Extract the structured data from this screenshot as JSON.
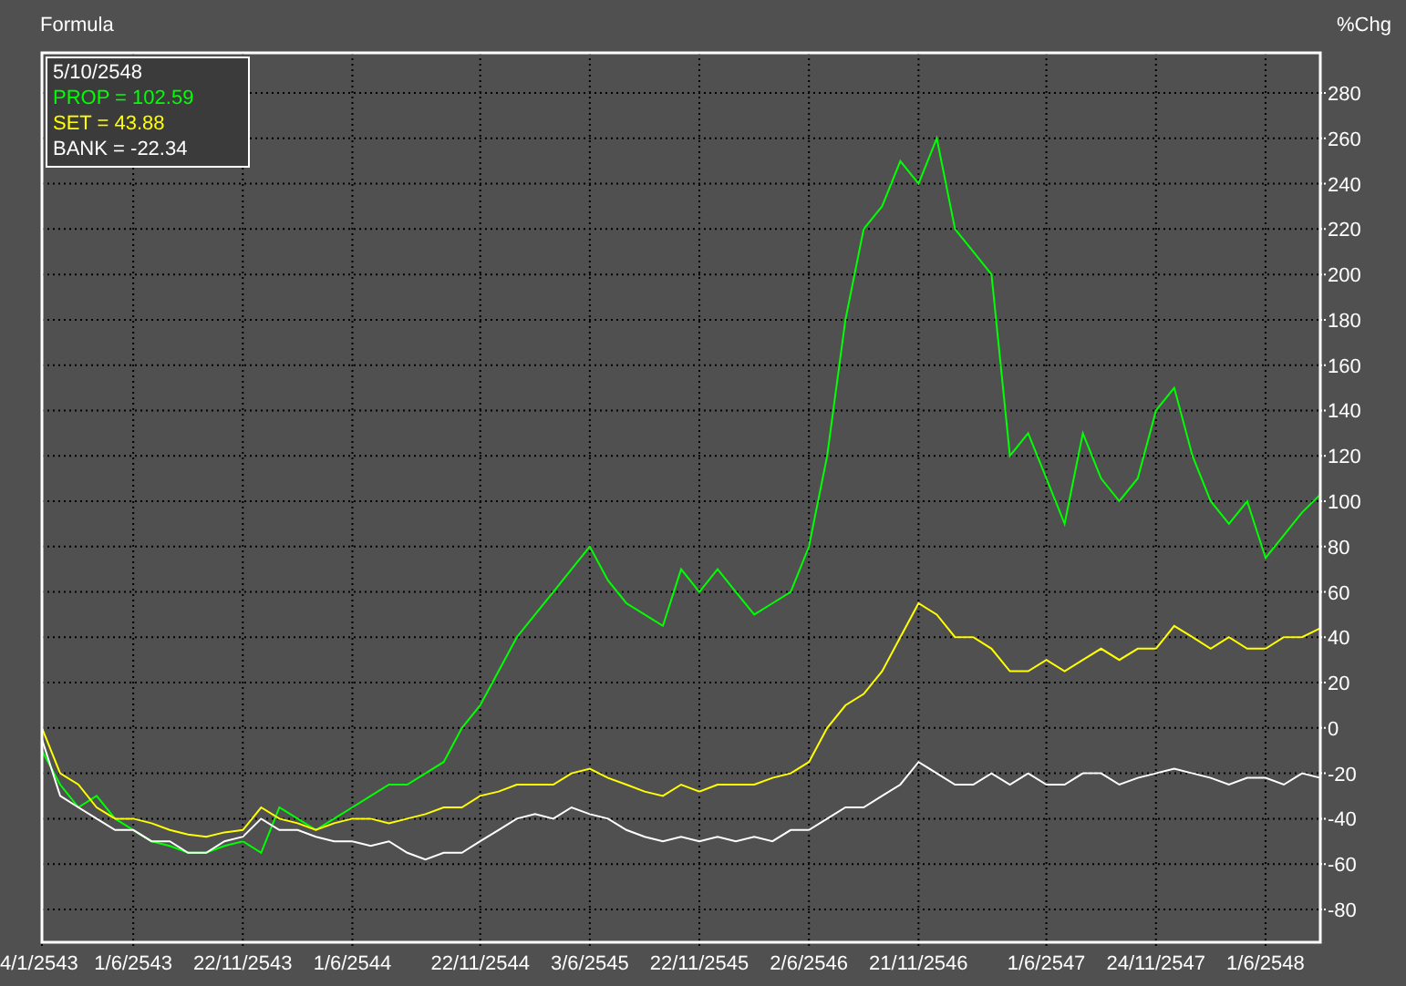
{
  "chart_title": "Formula",
  "legend": {
    "date": "5/10/2548",
    "items": [
      {
        "sign": "=",
        "value": "102.59"
      },
      {
        "sign": "=",
        "value": "43.88"
      },
      {
        "sign": "=",
        "value": "-22.34"
      }
    ]
  },
  "chart_data": {
    "type": "line",
    "grid": true,
    "ylabel": "%Chg",
    "ylim": [
      -94.5,
      297.7
    ],
    "yticks": [
      -80,
      -60,
      -40,
      -20,
      0,
      20,
      40,
      60,
      80,
      100,
      120,
      140,
      160,
      180,
      200,
      220,
      240,
      260,
      280
    ],
    "categories": [
      "4/1/2543",
      null,
      null,
      null,
      null,
      "1/6/2543",
      null,
      null,
      null,
      null,
      null,
      "22/11/2543",
      null,
      null,
      null,
      null,
      null,
      "1/6/2544",
      null,
      null,
      null,
      null,
      null,
      null,
      "22/11/2544",
      null,
      null,
      null,
      null,
      null,
      "3/6/2545",
      null,
      null,
      null,
      null,
      null,
      "22/11/2545",
      null,
      null,
      null,
      null,
      null,
      "2/6/2546",
      null,
      null,
      null,
      null,
      null,
      "21/11/2546",
      null,
      null,
      null,
      null,
      null,
      null,
      "1/6/2547",
      null,
      null,
      null,
      null,
      null,
      "24/11/2547",
      null,
      null,
      null,
      null,
      null,
      "1/6/2548",
      null,
      null,
      null
    ],
    "series": [
      {
        "name": "PROP",
        "color": "#00ff00",
        "values": [
          -10,
          -25,
          -35,
          -30,
          -40,
          -45,
          -50,
          -52,
          -55,
          -55,
          -52,
          -50,
          -55,
          -35,
          -40,
          -45,
          -40,
          -35,
          -30,
          -25,
          -25,
          -20,
          -15,
          0,
          10,
          25,
          40,
          50,
          60,
          70,
          80,
          65,
          55,
          50,
          45,
          70,
          60,
          70,
          60,
          50,
          55,
          60,
          80,
          120,
          180,
          220,
          230,
          250,
          240,
          260,
          220,
          210,
          200,
          120,
          130,
          110,
          90,
          130,
          110,
          100,
          110,
          140,
          150,
          120,
          100,
          90,
          100,
          75,
          85,
          95,
          103
        ]
      },
      {
        "name": "SET",
        "color": "#ffff00",
        "values": [
          0,
          -20,
          -25,
          -35,
          -40,
          -40,
          -42,
          -45,
          -47,
          -48,
          -46,
          -45,
          -35,
          -40,
          -42,
          -45,
          -42,
          -40,
          -40,
          -42,
          -40,
          -38,
          -35,
          -35,
          -30,
          -28,
          -25,
          -25,
          -25,
          -20,
          -18,
          -22,
          -25,
          -28,
          -30,
          -25,
          -28,
          -25,
          -25,
          -25,
          -22,
          -20,
          -15,
          0,
          10,
          15,
          25,
          40,
          55,
          50,
          40,
          40,
          35,
          25,
          25,
          30,
          25,
          30,
          35,
          30,
          35,
          35,
          45,
          40,
          35,
          40,
          35,
          35,
          40,
          40,
          44
        ]
      },
      {
        "name": "BANK",
        "color": "#ffffff",
        "values": [
          -5,
          -30,
          -35,
          -40,
          -45,
          -45,
          -50,
          -50,
          -55,
          -55,
          -50,
          -48,
          -40,
          -45,
          -45,
          -48,
          -50,
          -50,
          -52,
          -50,
          -55,
          -58,
          -55,
          -55,
          -50,
          -45,
          -40,
          -38,
          -40,
          -35,
          -38,
          -40,
          -45,
          -48,
          -50,
          -48,
          -50,
          -48,
          -50,
          -48,
          -50,
          -45,
          -45,
          -40,
          -35,
          -35,
          -30,
          -25,
          -15,
          -20,
          -25,
          -25,
          -20,
          -25,
          -20,
          -25,
          -25,
          -20,
          -20,
          -25,
          -22,
          -20,
          -18,
          -20,
          -22,
          -25,
          -22,
          -22,
          -25,
          -20,
          -22
        ]
      }
    ]
  }
}
